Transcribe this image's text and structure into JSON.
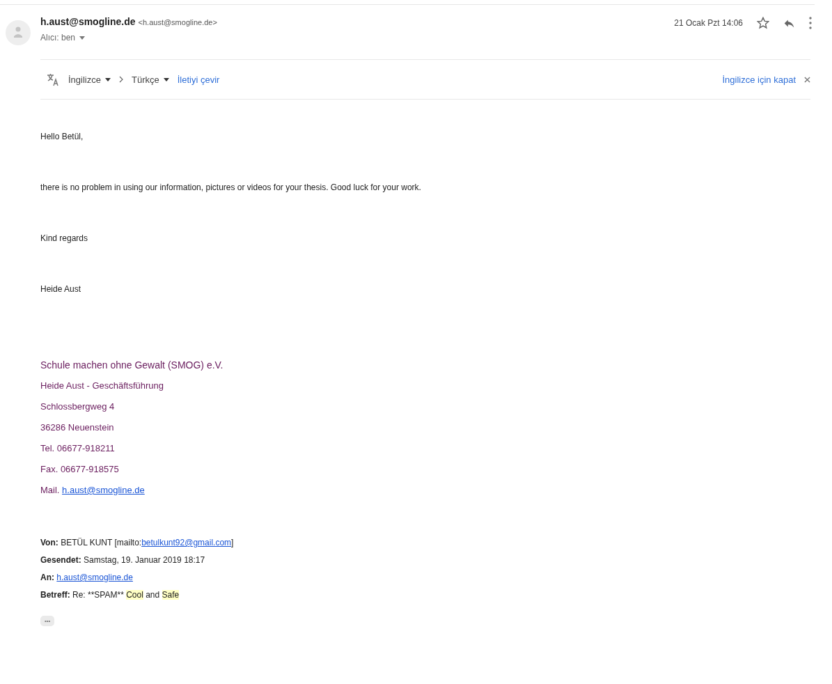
{
  "sender": {
    "name": "h.aust@smogline.de",
    "address": "<h.aust@smogline.de>",
    "recipient": "Alıcı: ben",
    "date": "21 Ocak Pzt 14:06",
    "starred": false
  },
  "translate_bar": {
    "source": "İngilizce",
    "target": "Türkçe",
    "action": "İletiyi çevir",
    "turn_off": "İngilizce için kapat"
  },
  "body": [
    "Hello Betül,",
    "there is no problem in using our information, pictures or videos for your thesis. Good luck for your work.",
    "Kind regards",
    "Heide Aust"
  ],
  "signature": [
    {
      "parts": [
        {
          "kind": "text",
          "text": "Schule machen ohne Gewalt (SMOG) e.V."
        }
      ]
    },
    {
      "parts": [
        {
          "kind": "text",
          "text": "Heide Aust - Geschäftsführung"
        }
      ]
    },
    {
      "parts": [
        {
          "kind": "text",
          "text": "Schlossbergweg 4"
        }
      ]
    },
    {
      "parts": [
        {
          "kind": "text",
          "text": "36286 Neuenstein"
        }
      ]
    },
    {
      "parts": [
        {
          "kind": "text",
          "text": "Tel. 06677-918211"
        }
      ]
    },
    {
      "parts": [
        {
          "kind": "text",
          "text": "Fax. 06677-918575"
        }
      ]
    },
    {
      "parts": [
        {
          "kind": "text",
          "text": "Mail. "
        },
        {
          "kind": "link",
          "text": "h.aust@smogline.de"
        }
      ]
    }
  ],
  "quoted_header": [
    {
      "label": "Von:",
      "parts": [
        {
          "kind": "text",
          "text": "BETÜL KUNT [mailto:"
        },
        {
          "kind": "link",
          "text": "betulkunt92@gmail.com"
        },
        {
          "kind": "text",
          "text": "]"
        }
      ]
    },
    {
      "label": "Gesendet:",
      "parts": [
        {
          "kind": "text",
          "text": "Samstag, 19. Januar 2019 18:17"
        }
      ]
    },
    {
      "label": "An:",
      "parts": [
        {
          "kind": "link",
          "text": "h.aust@smogline.de"
        }
      ]
    },
    {
      "label": "Betreff:",
      "parts": [
        {
          "kind": "text",
          "text": "Re: **SPAM** "
        },
        {
          "kind": "highlight",
          "text": "Cool"
        },
        {
          "kind": "text",
          "text": " and "
        },
        {
          "kind": "highlight",
          "text": "Safe"
        }
      ]
    }
  ],
  "show_trimmed": "•••"
}
